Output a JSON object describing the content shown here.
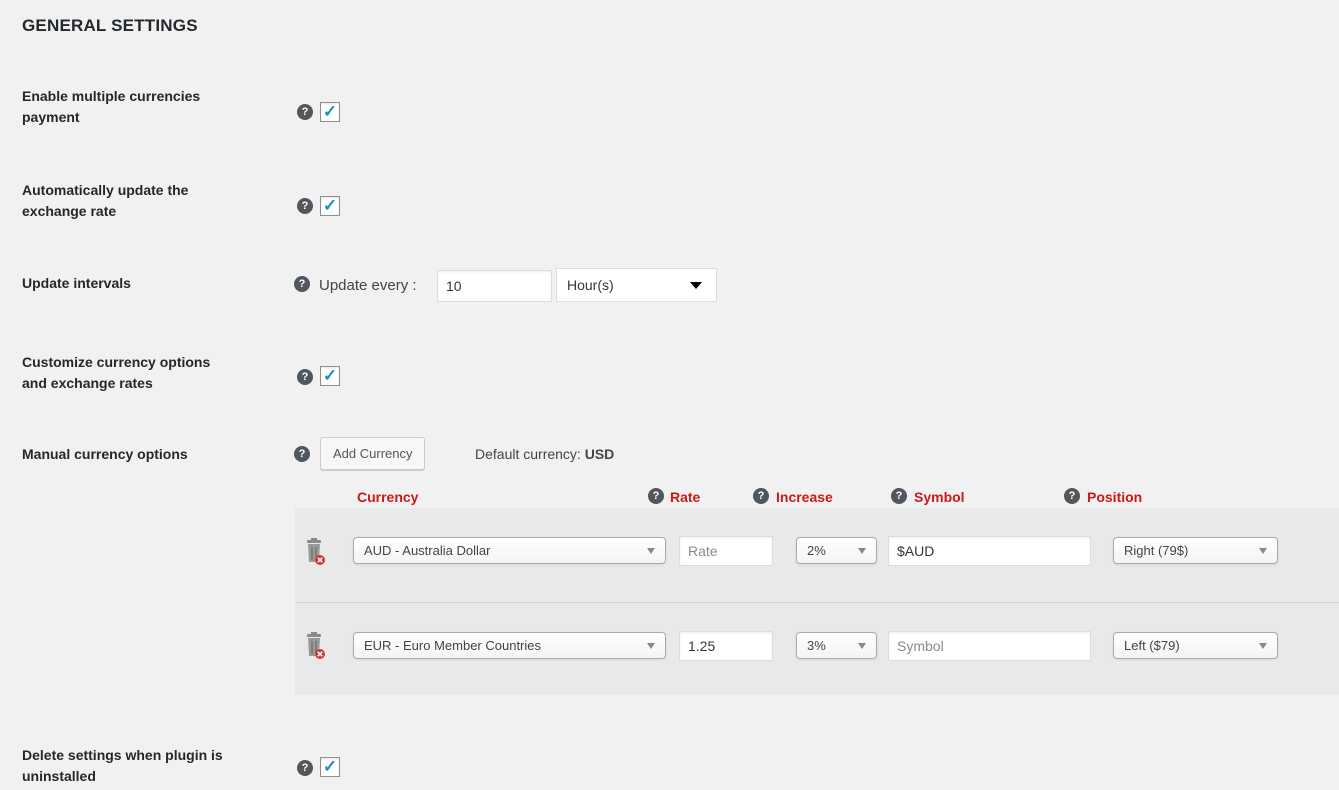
{
  "page": {
    "heading": "GENERAL SETTINGS"
  },
  "settings": {
    "enable_multi": {
      "label_line1": "Enable multiple currencies",
      "label_line2": "payment",
      "checked": true
    },
    "auto_update": {
      "label_line1": "Automatically update the",
      "label_line2": "exchange rate",
      "checked": true
    },
    "update_intervals": {
      "label": "Update intervals",
      "prefix": "Update every :",
      "value": "10",
      "unit": "Hour(s)"
    },
    "customize": {
      "label_line1": "Customize currency options",
      "label_line2": "and exchange rates",
      "checked": true
    },
    "manual": {
      "label": "Manual currency options",
      "add_button": "Add Currency",
      "default_prefix": "Default currency:",
      "default_value": "USD"
    },
    "delete_on_uninstall": {
      "label_line1": "Delete settings when plugin is",
      "label_line2": "uninstalled",
      "checked": true
    }
  },
  "help_glyph": "?",
  "check_glyph": "✓",
  "icons": {
    "help": "question-circle-icon",
    "checkbox": "checkmark-icon",
    "delete": "trash-delete-icon",
    "dropdown": "caret-down-icon"
  },
  "table": {
    "headers": {
      "currency": "Currency",
      "rate": "Rate",
      "increase": "Increase",
      "symbol": "Symbol",
      "position": "Position"
    },
    "rows": [
      {
        "currency": "AUD - Australia Dollar",
        "rate_value": "",
        "rate_placeholder": "Rate",
        "increase": "2%",
        "symbol_value": "$AUD",
        "symbol_placeholder": "Symbol",
        "position": "Right (79$)"
      },
      {
        "currency": "EUR - Euro Member Countries",
        "rate_value": "1.25",
        "rate_placeholder": "Rate",
        "increase": "3%",
        "symbol_value": "",
        "symbol_placeholder": "Symbol",
        "position": "Left ($79)"
      }
    ]
  },
  "colors": {
    "header_red": "#cc1818",
    "check_blue": "#1e8cbe",
    "background": "#f1f1f1"
  }
}
